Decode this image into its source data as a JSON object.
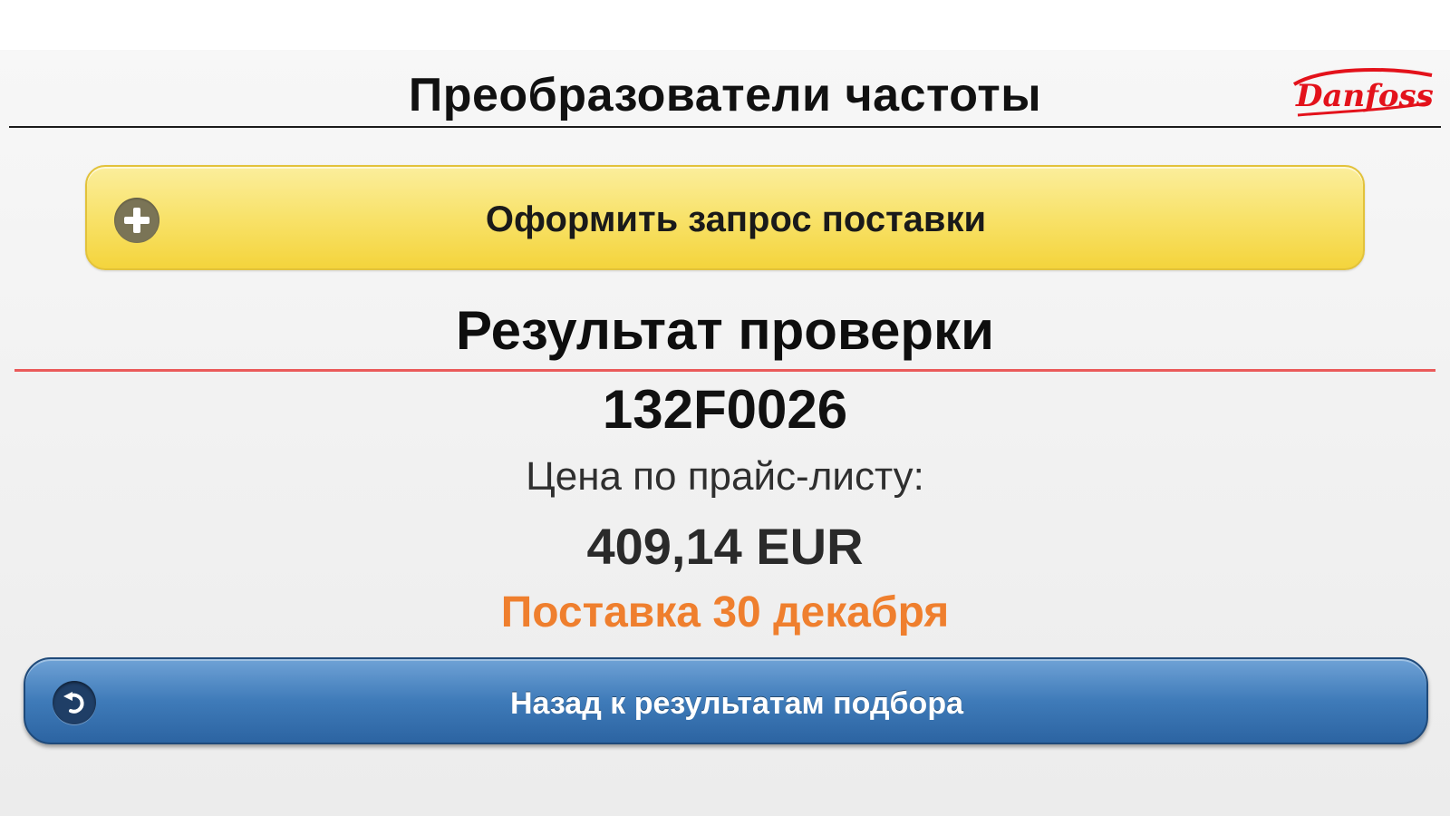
{
  "header": {
    "title": "Преобразователи частоты",
    "logo_text": "Danfoss"
  },
  "order_button": {
    "label": "Оформить запрос поставки",
    "icon": "plus-circle-icon"
  },
  "result": {
    "title": "Результат проверки",
    "part_number": "132F0026",
    "price_label": "Цена по прайс-листу:",
    "price_value": "409,14 EUR",
    "delivery": "Поставка 30 декабря"
  },
  "back_button": {
    "label": "Назад к результатам подбора",
    "icon": "undo-arrow-icon"
  },
  "colors": {
    "order_button": "#f8e26a",
    "back_button": "#3f7bb9",
    "delivery_text": "#ef7f2e",
    "divider_red": "#ea5a5a",
    "logo_red": "#e3121b"
  }
}
